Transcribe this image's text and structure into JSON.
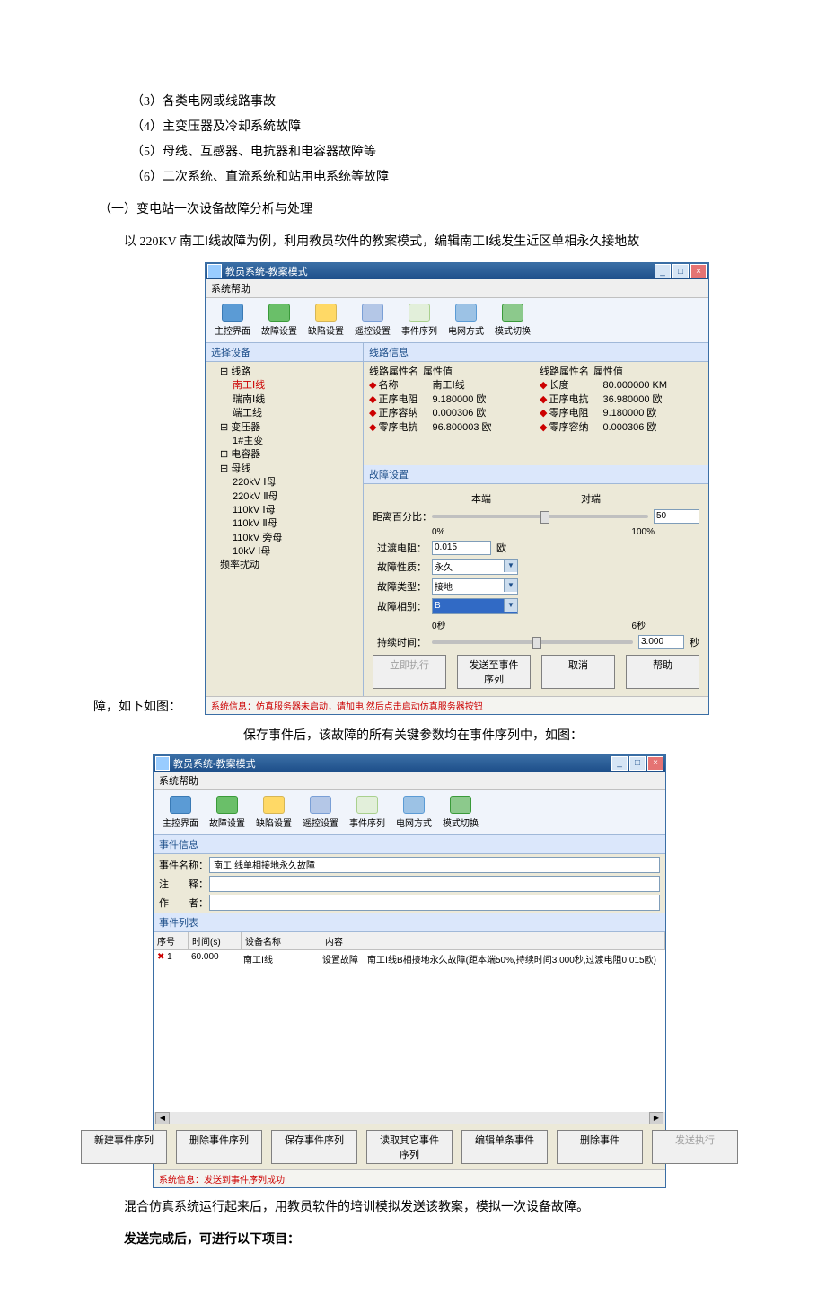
{
  "doc": {
    "li3": "（3）各类电网或线路事故",
    "li4": "（4）主变压器及冷却系统故障",
    "li5": "（5）母线、互感器、电抗器和电容器故障等",
    "li6": "（6）二次系统、直流系统和站用电系统等故障",
    "h1": "（一）变电站一次设备故障分析与处理",
    "p1a": "以 220KV 南工Ⅰ线故障为例，利用教员软件的教案模式，编辑南工Ⅰ线发生近区单相永久接地故",
    "p1b": "障，如下如图：",
    "cap1": "保存事件后，该故障的所有关键参数均在事件序列中，如图：",
    "p2": "混合仿真系统运行起来后，用教员软件的培训模拟发送该教案，模拟一次设备故障。",
    "p3": "发送完成后，可进行以下项目："
  },
  "win1": {
    "title": "教员系统-教案模式",
    "menu": "系统帮助",
    "toolbar": [
      "主控界面",
      "故障设置",
      "缺陷设置",
      "遥控设置",
      "事件序列",
      "电网方式",
      "模式切换"
    ],
    "left_hdr": "选择设备",
    "tree": {
      "n0": "线路",
      "n0_0": "南工Ⅰ线",
      "n0_1": "瑞南Ⅰ线",
      "n0_2": "端工线",
      "n1": "变压器",
      "n1_0": "1#主变",
      "n2": "电容器",
      "n3": "母线",
      "n3_0": "220kV Ⅰ母",
      "n3_1": "220kV Ⅱ母",
      "n3_2": "110kV Ⅰ母",
      "n3_3": "110kV Ⅱ母",
      "n3_4": "110kV 旁母",
      "n3_5": "10kV Ⅰ母",
      "n4": "频率扰动"
    },
    "right_hdr": "线路信息",
    "colh": {
      "a": "线路属性名",
      "b": "属性值",
      "c": "线路属性名",
      "d": "属性值"
    },
    "props": [
      {
        "n": "名称",
        "v": "南工Ⅰ线",
        "n2": "长度",
        "v2": "80.000000 KM"
      },
      {
        "n": "正序电阻",
        "v": "9.180000 欧",
        "n2": "正序电抗",
        "v2": "36.980000 欧"
      },
      {
        "n": "正序容纳",
        "v": "0.000306 欧",
        "n2": "零序电阻",
        "v2": "9.180000 欧"
      },
      {
        "n": "零序电抗",
        "v": "96.800003 欧",
        "n2": "零序容纳",
        "v2": "0.000306 欧"
      }
    ],
    "fault_hdr": "故障设置",
    "labels": {
      "local": "本端",
      "remote": "对端",
      "dist": "距离百分比：",
      "dist_val": "50",
      "pct0": "0%",
      "pct100": "100%",
      "res": "过渡电阻：",
      "res_val": "0.015",
      "res_unit": "欧",
      "nature": "故障性质：",
      "nature_val": "永久",
      "type": "故障类型：",
      "type_val": "接地",
      "phase": "故障相别：",
      "phase_val": "B",
      "t0": "0秒",
      "t6": "6秒",
      "dur": "持续时间：",
      "dur_val": "3.000",
      "sec": "秒"
    },
    "btns": {
      "exec": "立即执行",
      "send": "发送至事件序列",
      "cancel": "取消",
      "help": "帮助"
    },
    "status": "系统信息：仿真服务器未启动，请加电 然后点击启动仿真服务器按钮"
  },
  "win2": {
    "title": "教员系统-教案模式",
    "menu": "系统帮助",
    "toolbar": [
      "主控界面",
      "故障设置",
      "缺陷设置",
      "遥控设置",
      "事件序列",
      "电网方式",
      "模式切换"
    ],
    "info_hdr": "事件信息",
    "labels": {
      "name": "事件名称：",
      "note": "注　　释：",
      "author": "作　　者："
    },
    "name_val": "南工Ⅰ线单相接地永久故障",
    "list_hdr": "事件列表",
    "cols": {
      "seq": "序号",
      "time": "时间(s)",
      "dev": "设备名称",
      "cont": "内容"
    },
    "rows": [
      {
        "seq": "1",
        "time": "60.000",
        "dev": "南工Ⅰ线",
        "cont": "设置故障　南工Ⅰ线B相接地永久故障(距本端50%,持续时间3.000秒,过渡电阻0.015欧)"
      }
    ],
    "btns": {
      "new": "新建事件序列",
      "del": "删除事件序列",
      "save": "保存事件序列",
      "read": "读取其它事件序列",
      "edit": "编辑单条事件",
      "delone": "删除事件",
      "send": "发送执行"
    },
    "status": "系统信息：发送到事件序列成功"
  }
}
